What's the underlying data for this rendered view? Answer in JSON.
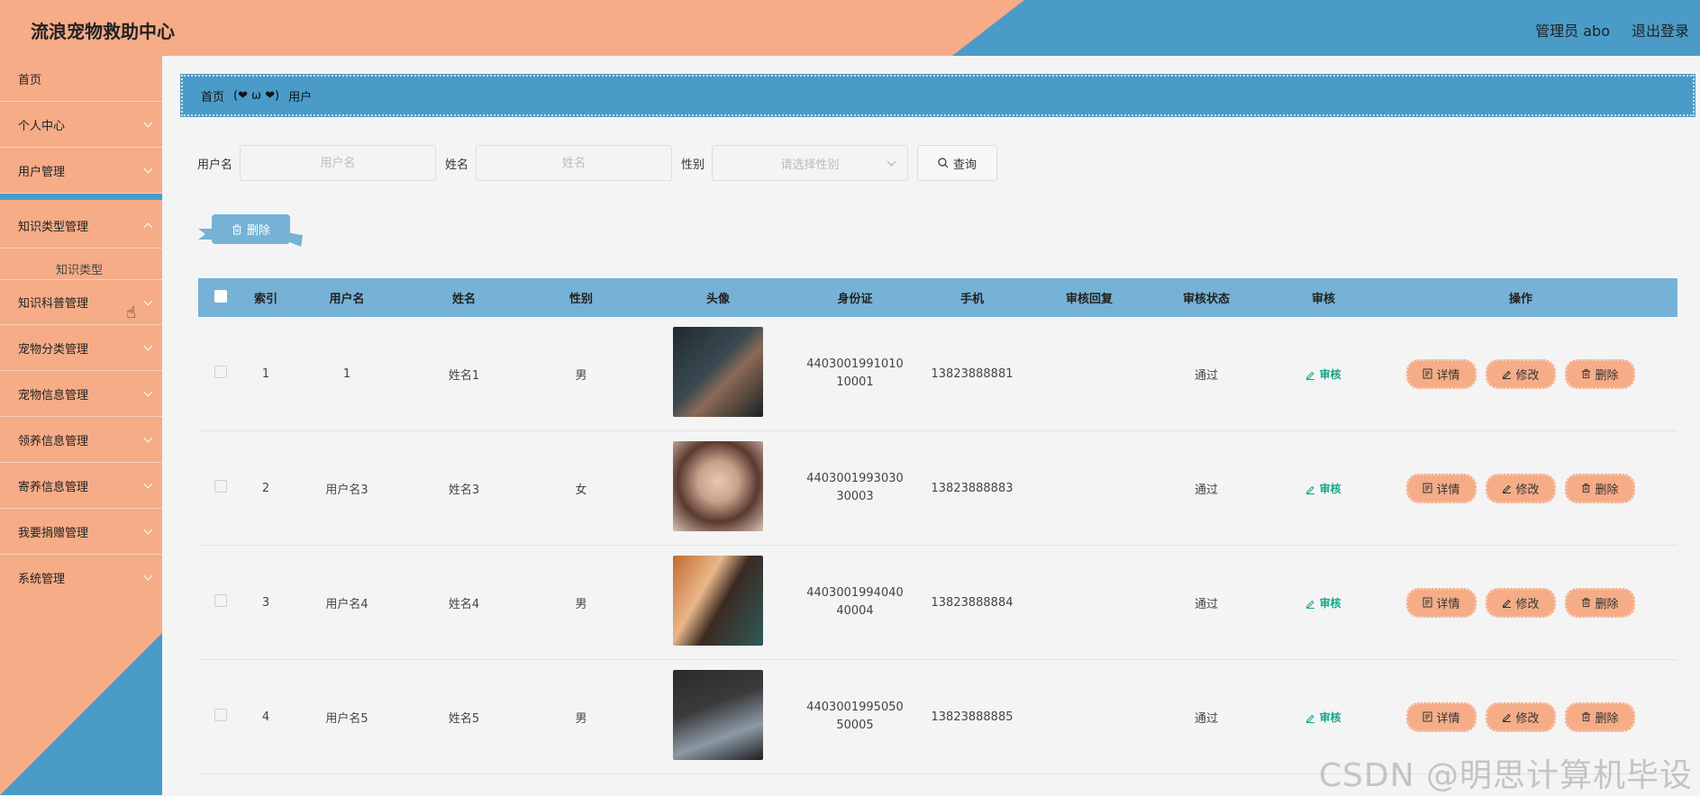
{
  "header": {
    "title": "流浪宠物救助中心",
    "user_label": "管理员 abo",
    "logout_label": "退出登录"
  },
  "sidebar": {
    "items": [
      {
        "label": "首页",
        "has_arrow": false
      },
      {
        "label": "个人中心",
        "has_arrow": true
      },
      {
        "label": "用户管理",
        "has_arrow": true
      },
      {
        "label": "知识类型管理",
        "has_arrow": true,
        "expanded": true
      },
      {
        "label": "知识科普管理",
        "has_arrow": true
      },
      {
        "label": "宠物分类管理",
        "has_arrow": true
      },
      {
        "label": "宠物信息管理",
        "has_arrow": true
      },
      {
        "label": "领养信息管理",
        "has_arrow": true
      },
      {
        "label": "寄养信息管理",
        "has_arrow": true
      },
      {
        "label": "我要捐赠管理",
        "has_arrow": true
      },
      {
        "label": "系统管理",
        "has_arrow": true
      }
    ],
    "submenu_label": "知识类型"
  },
  "breadcrumb": {
    "home": "首页",
    "separator": "(❤ ω ❤)",
    "current": "用户"
  },
  "search": {
    "username_label": "用户名",
    "username_placeholder": "用户名",
    "name_label": "姓名",
    "name_placeholder": "姓名",
    "gender_label": "性别",
    "gender_placeholder": "请选择性别",
    "query_label": "查询"
  },
  "toolbar": {
    "delete_label": "删除"
  },
  "table": {
    "columns": [
      "",
      "索引",
      "用户名",
      "姓名",
      "性别",
      "头像",
      "身份证",
      "手机",
      "审核回复",
      "审核状态",
      "审核",
      "操作"
    ],
    "rows": [
      {
        "index": "1",
        "username": "1",
        "name": "姓名1",
        "gender": "男",
        "id_line1": "4403001991010",
        "id_line2": "10001",
        "phone": "13823888881",
        "reply": "",
        "status": "通过"
      },
      {
        "index": "2",
        "username": "用户名3",
        "name": "姓名3",
        "gender": "女",
        "id_line1": "4403001993030",
        "id_line2": "30003",
        "phone": "13823888883",
        "reply": "",
        "status": "通过"
      },
      {
        "index": "3",
        "username": "用户名4",
        "name": "姓名4",
        "gender": "男",
        "id_line1": "4403001994040",
        "id_line2": "40004",
        "phone": "13823888884",
        "reply": "",
        "status": "通过"
      },
      {
        "index": "4",
        "username": "用户名5",
        "name": "姓名5",
        "gender": "男",
        "id_line1": "4403001995050",
        "id_line2": "50005",
        "phone": "13823888885",
        "reply": "",
        "status": "通过"
      }
    ],
    "audit_label": "审核",
    "detail_label": "详情",
    "edit_label": "修改",
    "row_delete_label": "删除"
  },
  "watermark": "CSDN @明思计算机毕设",
  "colors": {
    "orange": "#f5ac87",
    "blue": "#4a9bc8",
    "table_header": "#76b2d5",
    "audit_green": "#1aa58a"
  }
}
